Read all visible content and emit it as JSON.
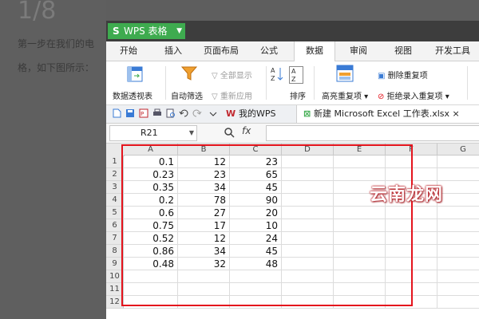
{
  "background": {
    "step": "1/8",
    "text_line1": "第一步在我们的电",
    "text_line2": "格，如下图所示："
  },
  "app": {
    "name": "WPS 表格",
    "logo": "S",
    "tabs": [
      "开始",
      "插入",
      "页面布局",
      "公式",
      "数据",
      "审阅",
      "视图",
      "开发工具"
    ],
    "active_tab": "数据",
    "ribbon": {
      "pivot": "数据透视表",
      "autofilter": "自动筛选",
      "show_all": "全部显示",
      "reapply": "重新应用",
      "sort": "排序",
      "highlight_dup": "高亮重复项",
      "delete_dup": "删除重复项",
      "reject_dup": "拒绝录入重复项"
    },
    "doc_tabs": {
      "mywps": "我的WPS",
      "file": "新建 Microsoft Excel 工作表.xlsx"
    },
    "name_box": "R21",
    "fx": "fx",
    "columns": [
      "A",
      "B",
      "C",
      "D",
      "E",
      "F",
      "G"
    ],
    "rows": [
      "1",
      "2",
      "3",
      "4",
      "5",
      "6",
      "7",
      "8",
      "9",
      "10",
      "11",
      "12"
    ],
    "data": [
      [
        "0.1",
        "12",
        "23"
      ],
      [
        "0.23",
        "23",
        "65"
      ],
      [
        "0.35",
        "34",
        "45"
      ],
      [
        "0.2",
        "78",
        "90"
      ],
      [
        "0.6",
        "27",
        "20"
      ],
      [
        "0.75",
        "17",
        "10"
      ],
      [
        "0.52",
        "12",
        "24"
      ],
      [
        "0.86",
        "34",
        "45"
      ],
      [
        "0.48",
        "32",
        "48"
      ]
    ]
  },
  "watermark": "云南龙网",
  "colors": {
    "wps_green": "#3eab4f",
    "highlight_red": "#e4141d"
  }
}
